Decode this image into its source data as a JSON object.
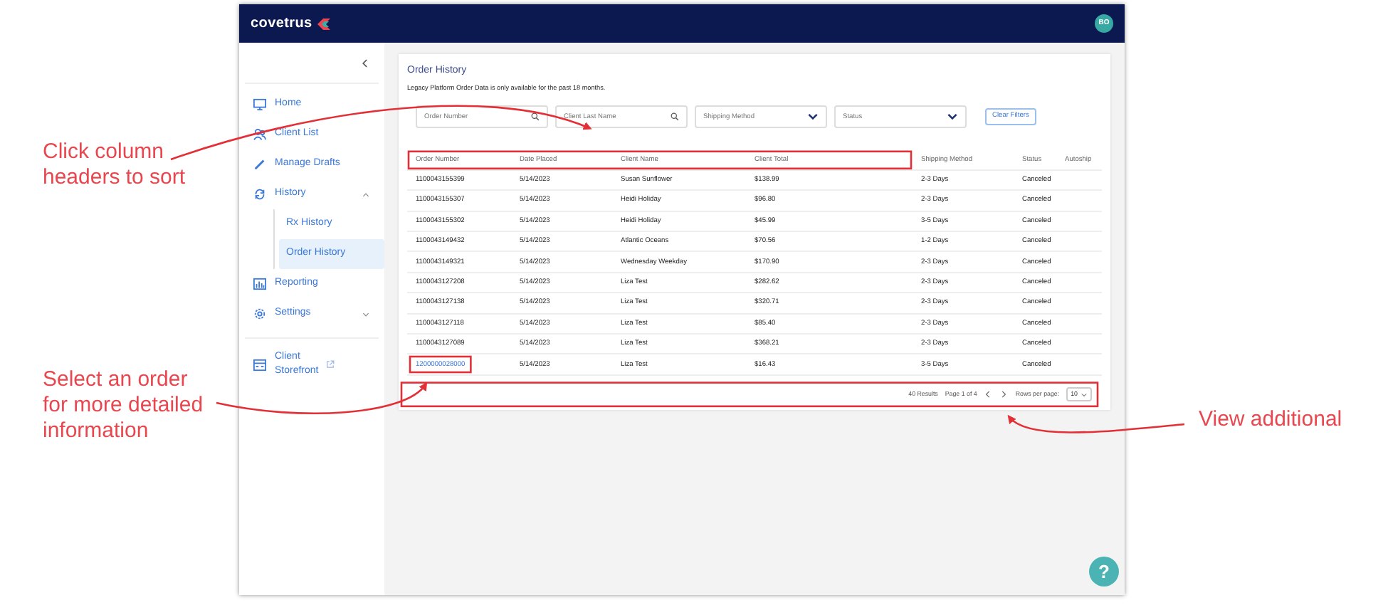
{
  "annotations": [
    {
      "text": "Click column\nheaders to sort"
    },
    {
      "text": "Select an order\nfor more detailed\ninformation"
    },
    {
      "text": "View additional"
    }
  ],
  "app": {
    "logo": "covetrus",
    "avatar": "BO"
  },
  "sidebar": {
    "items": [
      {
        "label": "Home",
        "kind": "link",
        "selected": false
      },
      {
        "label": "Client List",
        "kind": "link",
        "selected": false
      },
      {
        "label": "Manage Drafts",
        "kind": "link",
        "selected": false
      },
      {
        "label": "History",
        "kind": "group",
        "expanded": true,
        "children": [
          {
            "label": "Rx History",
            "selected": false
          },
          {
            "label": "Order History",
            "selected": true
          }
        ]
      },
      {
        "label": "Reporting",
        "kind": "link",
        "selected": false
      },
      {
        "label": "Settings",
        "kind": "group",
        "expanded": false
      },
      {
        "label": "Client Storefront",
        "kind": "external",
        "selected": false
      }
    ]
  },
  "page": {
    "title": "Order History",
    "notice": "Legacy Platform Order Data is only available for the past 18 months.",
    "filters": [
      {
        "kind": "search",
        "placeholder": "Order Number"
      },
      {
        "kind": "search",
        "placeholder": "Client Last Name"
      },
      {
        "kind": "select",
        "placeholder": "Shipping Method"
      },
      {
        "kind": "select",
        "placeholder": "Status"
      }
    ],
    "clear_button": "Clear Filters"
  },
  "table": {
    "columns": [
      "Order Number",
      "Date Placed",
      "Client Name",
      "Client Total",
      "Shipping Method",
      "Status",
      "Autoship"
    ],
    "rows": [
      {
        "linked": false,
        "cells": [
          "1100043155399",
          "5/14/2023",
          "Susan Sunflower",
          "$138.99",
          "2-3 Days",
          "Canceled"
        ]
      },
      {
        "linked": false,
        "cells": [
          "1100043155307",
          "5/14/2023",
          "Heidi Holiday",
          "$96.80",
          "2-3 Days",
          "Canceled"
        ]
      },
      {
        "linked": false,
        "cells": [
          "1100043155302",
          "5/14/2023",
          "Heidi Holiday",
          "$45.99",
          "3-5 Days",
          "Canceled"
        ]
      },
      {
        "linked": false,
        "cells": [
          "1100043149432",
          "5/14/2023",
          "Atlantic Oceans",
          "$70.56",
          "1-2 Days",
          "Canceled"
        ]
      },
      {
        "linked": false,
        "cells": [
          "1100043149321",
          "5/14/2023",
          "Wednesday Weekday",
          "$170.90",
          "2-3 Days",
          "Canceled"
        ]
      },
      {
        "linked": false,
        "cells": [
          "1100043127208",
          "5/14/2023",
          "Liza Test",
          "$282.62",
          "2-3 Days",
          "Canceled"
        ]
      },
      {
        "linked": false,
        "cells": [
          "1100043127138",
          "5/14/2023",
          "Liza Test",
          "$320.71",
          "2-3 Days",
          "Canceled"
        ]
      },
      {
        "linked": false,
        "cells": [
          "1100043127118",
          "5/14/2023",
          "Liza Test",
          "$85.40",
          "2-3 Days",
          "Canceled"
        ]
      },
      {
        "linked": false,
        "cells": [
          "1100043127089",
          "5/14/2023",
          "Liza Test",
          "$368.21",
          "2-3 Days",
          "Canceled"
        ]
      },
      {
        "linked": true,
        "cells": [
          "1200000028000",
          "5/14/2023",
          "Liza Test",
          "$16.43",
          "3-5 Days",
          "Canceled"
        ]
      }
    ]
  },
  "pagination": {
    "results": "40 Results",
    "page": "Page 1 of 4",
    "rows_label": "Rows per page:",
    "rows_value": "10"
  },
  "help": "?"
}
